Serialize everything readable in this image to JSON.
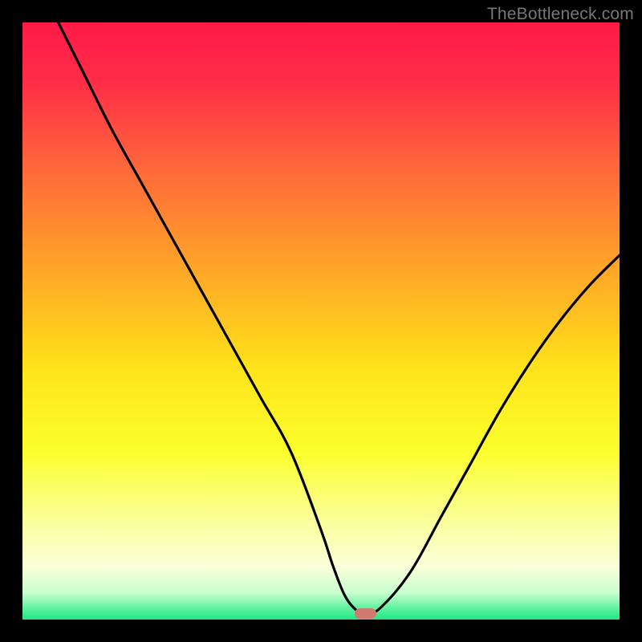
{
  "watermark": "TheBottleneck.com",
  "colors": {
    "frame": "#000000",
    "gradient_stops": [
      {
        "offset": 0.0,
        "color": "#ff1a48"
      },
      {
        "offset": 0.1,
        "color": "#ff2d47"
      },
      {
        "offset": 0.25,
        "color": "#ff6a3a"
      },
      {
        "offset": 0.45,
        "color": "#ffb324"
      },
      {
        "offset": 0.58,
        "color": "#ffe31a"
      },
      {
        "offset": 0.72,
        "color": "#fcff2d"
      },
      {
        "offset": 0.84,
        "color": "#faffa0"
      },
      {
        "offset": 0.91,
        "color": "#fbffd8"
      },
      {
        "offset": 0.955,
        "color": "#c9ffcf"
      },
      {
        "offset": 0.985,
        "color": "#50f09a"
      },
      {
        "offset": 1.0,
        "color": "#20e886"
      }
    ],
    "curve": "#000000",
    "marker": "#cf7a71"
  },
  "chart_data": {
    "type": "line",
    "title": "",
    "xlabel": "",
    "ylabel": "",
    "xlim": [
      0,
      100
    ],
    "ylim": [
      0,
      100
    ],
    "series": [
      {
        "name": "bottleneck-curve",
        "x": [
          6,
          10,
          15,
          20,
          25,
          30,
          35,
          40,
          45,
          50,
          52,
          54,
          56,
          57.5,
          60,
          65,
          70,
          75,
          80,
          85,
          90,
          95,
          100
        ],
        "values": [
          100,
          92,
          82,
          73,
          64,
          55,
          46,
          37,
          28,
          15,
          9,
          4,
          1.5,
          1,
          2,
          8,
          17,
          26,
          35,
          43,
          50,
          56,
          61
        ]
      }
    ],
    "marker": {
      "x": 57.5,
      "y": 1,
      "width_pct": 3.6,
      "height_pct": 1.8
    },
    "grid": false,
    "legend": false
  }
}
